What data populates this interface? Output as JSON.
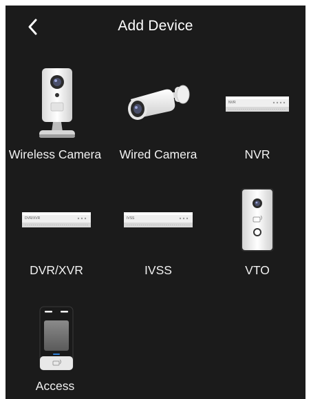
{
  "header": {
    "title": "Add Device",
    "back_icon": "chevron-left-icon"
  },
  "devices": [
    {
      "label": "Wireless Camera",
      "icon": "wireless-camera-icon"
    },
    {
      "label": "Wired Camera",
      "icon": "bullet-camera-icon"
    },
    {
      "label": "NVR",
      "icon": "nvr-recorder-icon",
      "device_text": "NVR"
    },
    {
      "label": "DVR/XVR",
      "icon": "dvr-recorder-icon",
      "device_text": "DVR/XVR"
    },
    {
      "label": "IVSS",
      "icon": "ivss-recorder-icon",
      "device_text": "IVSS"
    },
    {
      "label": "VTO",
      "icon": "vto-doorbell-icon"
    },
    {
      "label": "Access",
      "icon": "access-terminal-icon"
    }
  ],
  "colors": {
    "background": "#1b1b1b",
    "text": "#f2f2f2"
  }
}
